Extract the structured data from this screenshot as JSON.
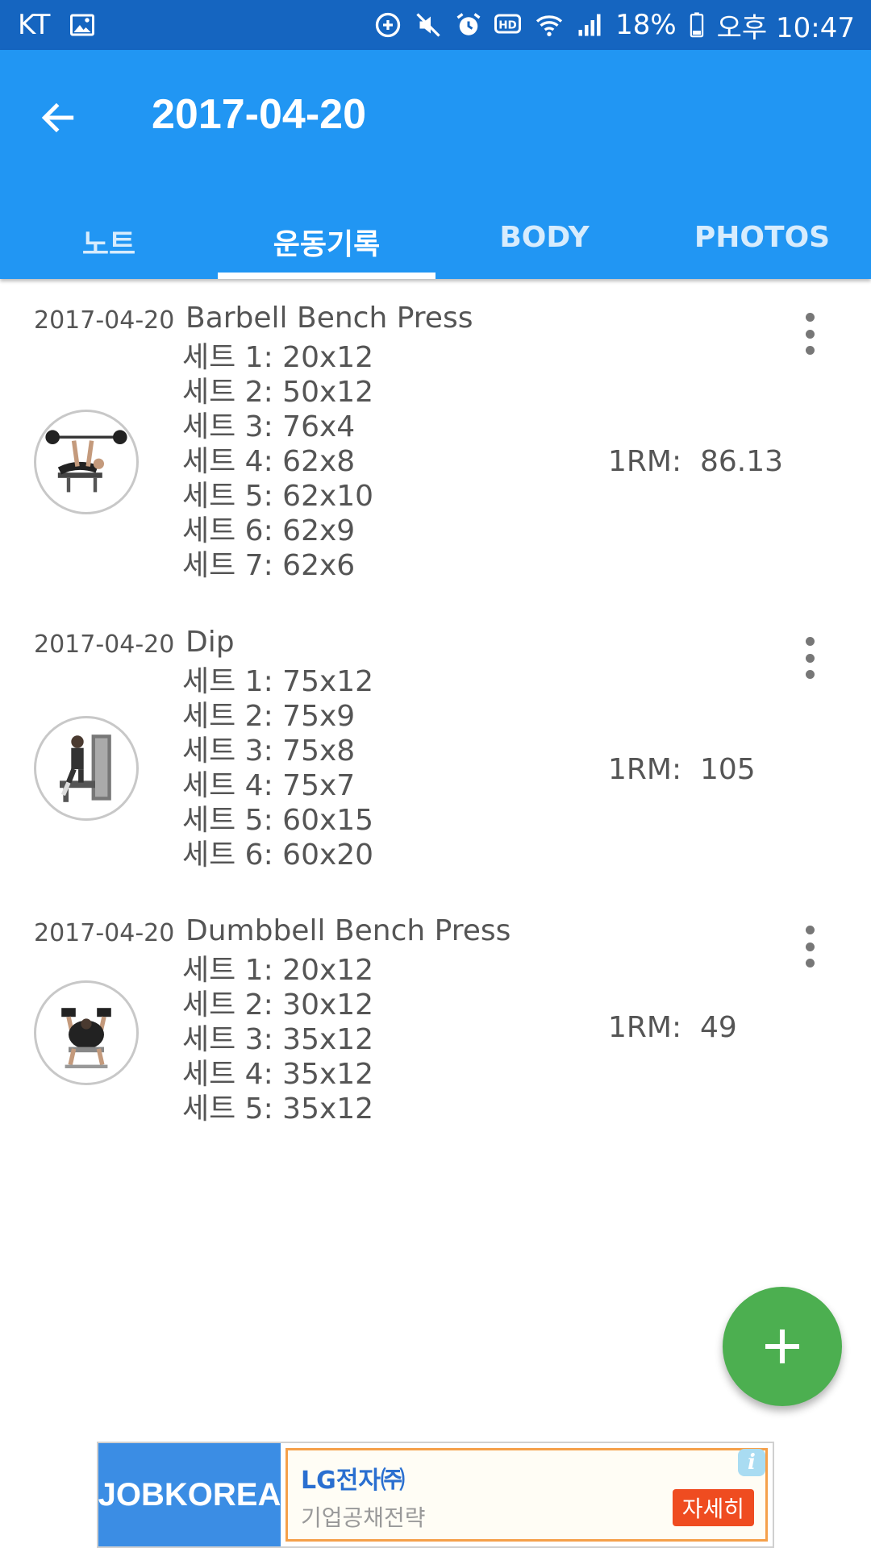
{
  "status_bar": {
    "carrier": "KT",
    "battery": "18%",
    "time": "오후 10:47"
  },
  "app_bar": {
    "title": "2017-04-20"
  },
  "tabs": [
    {
      "label": "노트",
      "active": false
    },
    {
      "label": "운동기록",
      "active": true
    },
    {
      "label": "BODY",
      "active": false
    },
    {
      "label": "PHOTOS",
      "active": false
    }
  ],
  "entries": [
    {
      "date": "2017-04-20",
      "name": "Barbell Bench Press",
      "sets": [
        "세트 1: 20x12",
        "세트 2: 50x12",
        "세트 3: 76x4",
        "세트 4: 62x8",
        "세트 5: 62x10",
        "세트 6: 62x9",
        "세트 7: 62x6"
      ],
      "one_rm": "1RM:  86.13",
      "icon": "barbell-bench-press-icon"
    },
    {
      "date": "2017-04-20",
      "name": "Dip",
      "sets": [
        "세트 1: 75x12",
        "세트 2: 75x9",
        "세트 3: 75x8",
        "세트 4: 75x7",
        "세트 5: 60x15",
        "세트 6: 60x20"
      ],
      "one_rm": "1RM:  105",
      "icon": "dip-machine-icon"
    },
    {
      "date": "2017-04-20",
      "name": "Dumbbell Bench Press",
      "sets": [
        "세트 1: 20x12",
        "세트 2: 30x12",
        "세트 3: 35x12",
        "세트 4: 35x12",
        "세트 5: 35x12"
      ],
      "one_rm": "1RM:  49",
      "icon": "dumbbell-bench-press-icon"
    }
  ],
  "ad": {
    "logo": "JOBKOREA",
    "company": "LG전자㈜",
    "description": "기업공채전략",
    "cta": "자세히",
    "info": "i"
  },
  "colors": {
    "status_bar": "#1565c0",
    "app_bar": "#2196f3",
    "fab": "#4caf50",
    "ad_cta": "#ef4c20"
  }
}
